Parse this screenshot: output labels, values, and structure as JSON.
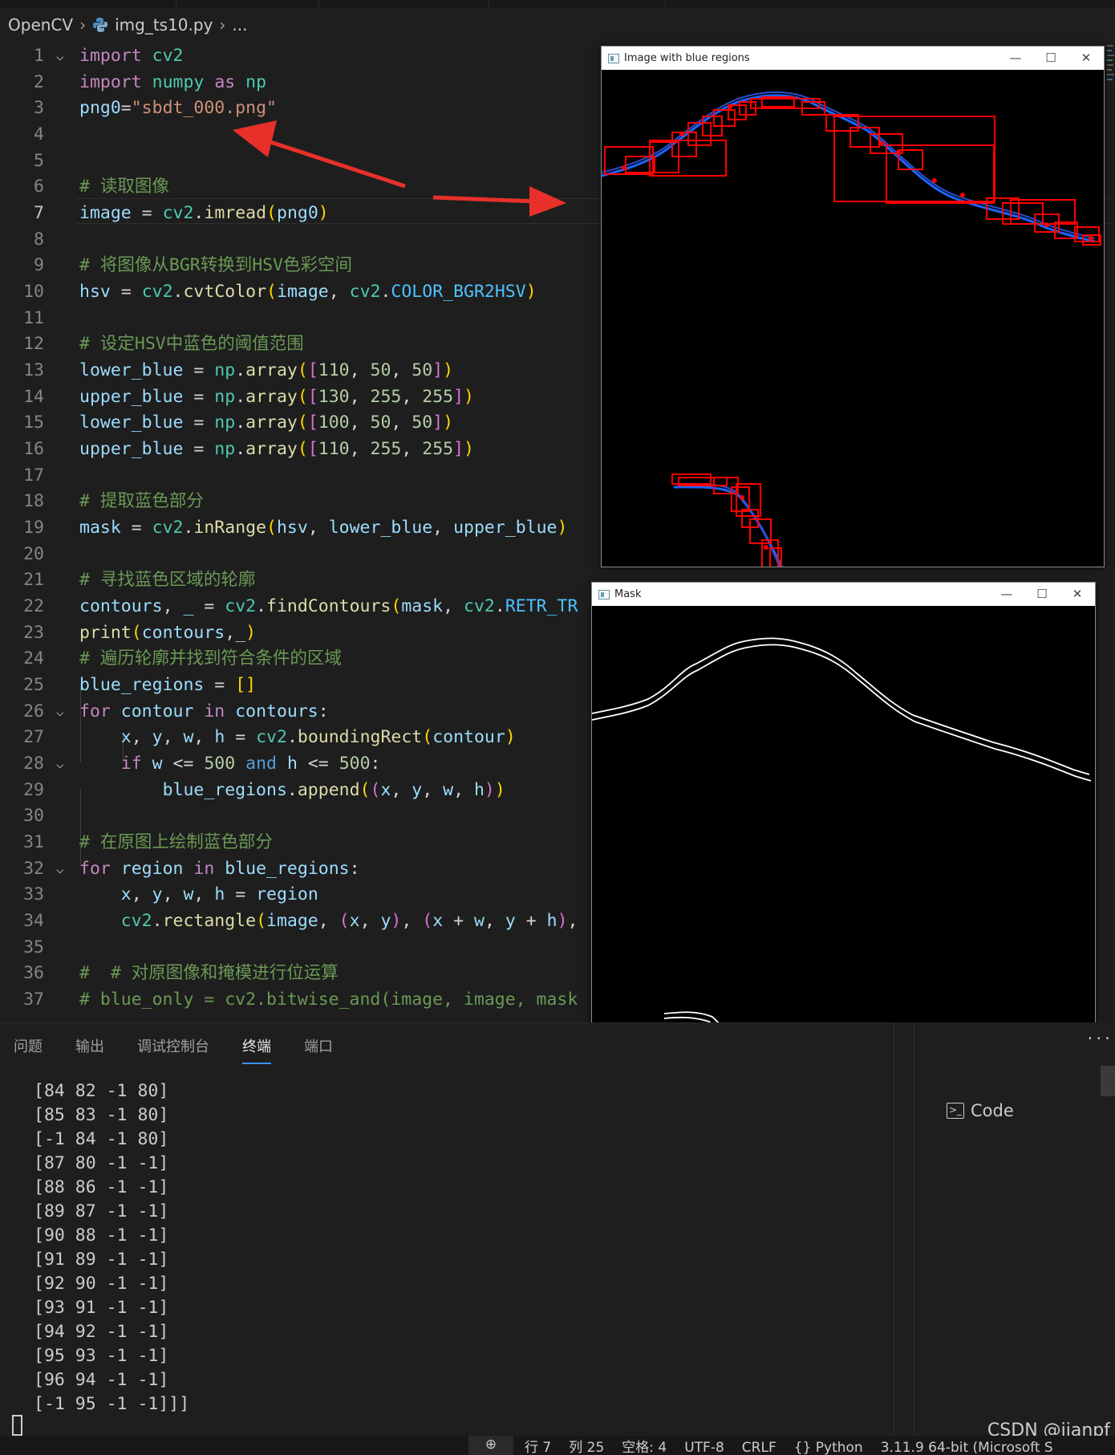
{
  "breadcrumb": {
    "folder": "OpenCV",
    "file": "img_ts10.py",
    "more": "..."
  },
  "editor": {
    "lines": [
      {
        "n": "1"
      },
      {
        "n": "2"
      },
      {
        "n": "3"
      },
      {
        "n": "4"
      },
      {
        "n": "5"
      },
      {
        "n": "6"
      },
      {
        "n": "7"
      },
      {
        "n": "8"
      },
      {
        "n": "9"
      },
      {
        "n": "10"
      },
      {
        "n": "11"
      },
      {
        "n": "12"
      },
      {
        "n": "13"
      },
      {
        "n": "14"
      },
      {
        "n": "15"
      },
      {
        "n": "16"
      },
      {
        "n": "17"
      },
      {
        "n": "18"
      },
      {
        "n": "19"
      },
      {
        "n": "20"
      },
      {
        "n": "21"
      },
      {
        "n": "22"
      },
      {
        "n": "23"
      },
      {
        "n": "24"
      },
      {
        "n": "25"
      },
      {
        "n": "26"
      },
      {
        "n": "27"
      },
      {
        "n": "28"
      },
      {
        "n": "29"
      },
      {
        "n": "30"
      },
      {
        "n": "31"
      },
      {
        "n": "32"
      },
      {
        "n": "33"
      },
      {
        "n": "34"
      },
      {
        "n": "35"
      },
      {
        "n": "36"
      },
      {
        "n": "37"
      }
    ],
    "active_line": "7",
    "comments": {
      "c6": "# 读取图像",
      "c9": "# 将图像从BGR转换到HSV色彩空间",
      "c12": "# 设定HSV中蓝色的阈值范围",
      "c18": "# 提取蓝色部分",
      "c21": "# 寻找蓝色区域的轮廓",
      "c24": "# 遍历轮廓并找到符合条件的区域",
      "c31": "# 在原图上绘制蓝色部分",
      "c36": "#  # 对原图像和掩模进行位运算",
      "c37": "# blue_only = cv2.bitwise_and(image, image, mask"
    }
  },
  "windows": {
    "blue": {
      "title": "Image with blue regions",
      "minimize": "—",
      "maximize": "☐",
      "close": "✕"
    },
    "mask": {
      "title": "Mask",
      "minimize": "—",
      "maximize": "☐",
      "close": "✕"
    }
  },
  "panel": {
    "tabs": [
      "问题",
      "输出",
      "调试控制台",
      "终端",
      "端口"
    ],
    "active_tab": "终端",
    "terminal_lines": [
      "[84 82 -1 80]",
      "[85 83 -1 80]",
      "[-1 84 -1 80]",
      "[87 80 -1 -1]",
      "[88 86 -1 -1]",
      "[89 87 -1 -1]",
      "[90 88 -1 -1]",
      "[91 89 -1 -1]",
      "[92 90 -1 -1]",
      "[93 91 -1 -1]",
      "[94 92 -1 -1]",
      "[95 93 -1 -1]",
      "[96 94 -1 -1]",
      "[-1 95 -1 -1]]]"
    ],
    "more": "···"
  },
  "right_panel": {
    "item": "Code"
  },
  "statusbar": {
    "line": "行 7",
    "col": "列 25",
    "spaces": "空格: 4",
    "encoding": "UTF-8",
    "eol": "CRLF",
    "language": "{} Python",
    "interpreter": "3.11.9 64-bit (Microsoft S"
  },
  "watermark": "CSDN @jianpf",
  "colors": {
    "accent": "#3794ff",
    "arrow": "#e8302a",
    "box": "#ff0000",
    "curve": "#1e64ff"
  }
}
